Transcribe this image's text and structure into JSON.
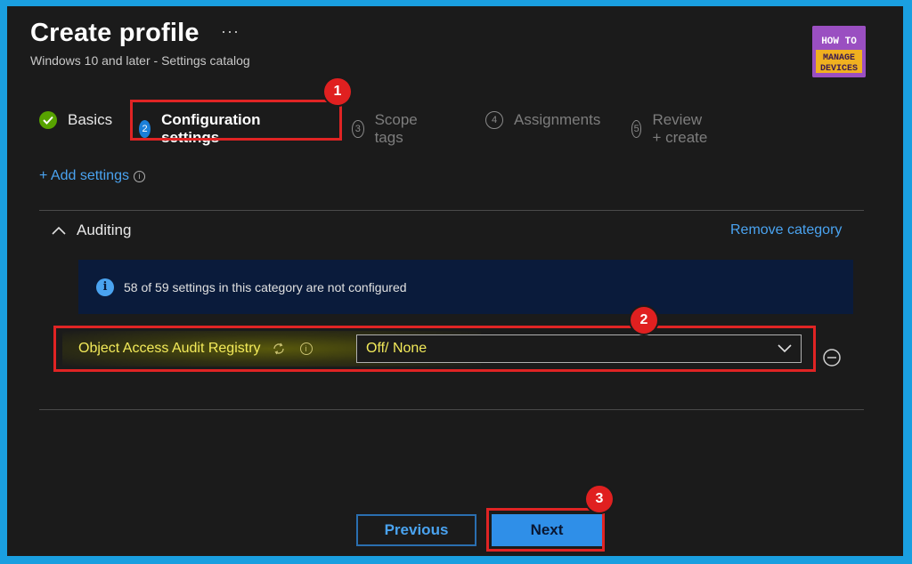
{
  "header": {
    "title": "Create profile",
    "more_icon": "more-horizontal-icon",
    "subtitle": "Windows 10 and later - Settings catalog"
  },
  "logo": {
    "line1": "HOW TO",
    "line2": "MANAGE",
    "line3": "DEVICES"
  },
  "steps": [
    {
      "number": "",
      "label": "Basics",
      "state": "done",
      "icon": "checkmark-circle-icon"
    },
    {
      "number": "2",
      "label": "Configuration settings",
      "state": "active"
    },
    {
      "number": "3",
      "label": "Scope tags",
      "state": "pending"
    },
    {
      "number": "4",
      "label": "Assignments",
      "state": "pending"
    },
    {
      "number": "5",
      "label": "Review + create",
      "state": "pending"
    }
  ],
  "add_settings": {
    "label": "+ Add settings",
    "info": "i"
  },
  "category": {
    "name": "Auditing",
    "remove_label": "Remove category",
    "notice": "58 of 59 settings in this category are not configured",
    "notice_icon": "i",
    "setting": {
      "label": "Object Access Audit Registry",
      "info": "i",
      "value": "Off/ None"
    }
  },
  "annotations": [
    "1",
    "2",
    "3"
  ],
  "footer": {
    "previous_label": "Previous",
    "next_label": "Next"
  },
  "colors": {
    "accent": "#4aa3f0",
    "highlight": "#e02424",
    "setting_text": "#f3ea5a",
    "notice_bg": "#0a1b3b"
  }
}
